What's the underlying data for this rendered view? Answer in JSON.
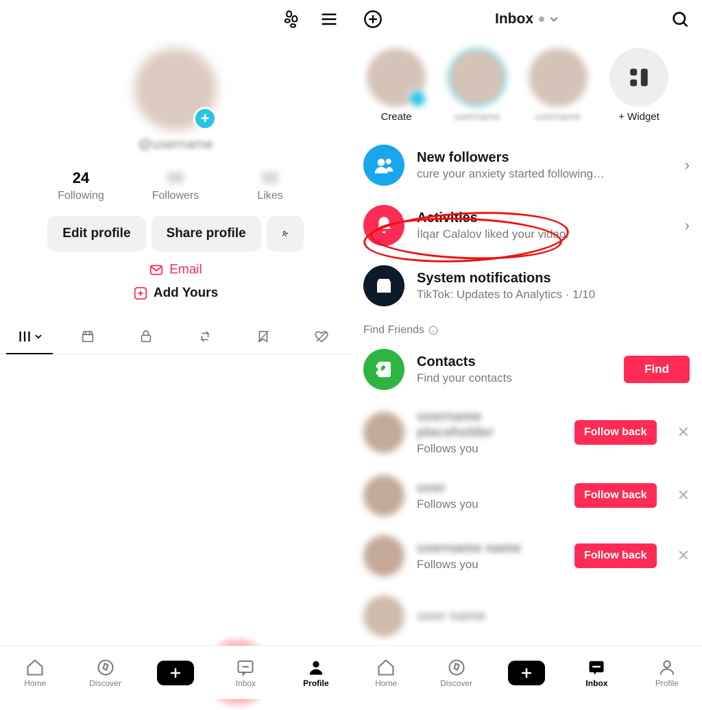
{
  "left": {
    "handle": "@username",
    "stats": {
      "following_count": "24",
      "following_label": "Following",
      "followers_label": "Followers",
      "likes_label": "Likes"
    },
    "actions": {
      "edit": "Edit profile",
      "share": "Share profile"
    },
    "email": "Email",
    "add_yours": "Add Yours"
  },
  "right": {
    "header_title": "Inbox",
    "stories": {
      "create": "Create",
      "widget": "+ Widget"
    },
    "items": {
      "followers": {
        "title": "New followers",
        "sub": "cure your anxiety started following…"
      },
      "activities": {
        "title": "Activities",
        "sub": "İlqar Calalov liked your video."
      },
      "system": {
        "title": "System notifications",
        "sub": "TikTok: Updates to Analytics  · 1/10"
      }
    },
    "find_friends": "Find Friends",
    "contacts": {
      "title": "Contacts",
      "sub": "Find your contacts",
      "btn": "Find"
    },
    "follows_you": "Follows you",
    "follow_back": "Follow back"
  },
  "nav": {
    "home": "Home",
    "discover": "Discover",
    "inbox": "Inbox",
    "profile": "Profile"
  }
}
